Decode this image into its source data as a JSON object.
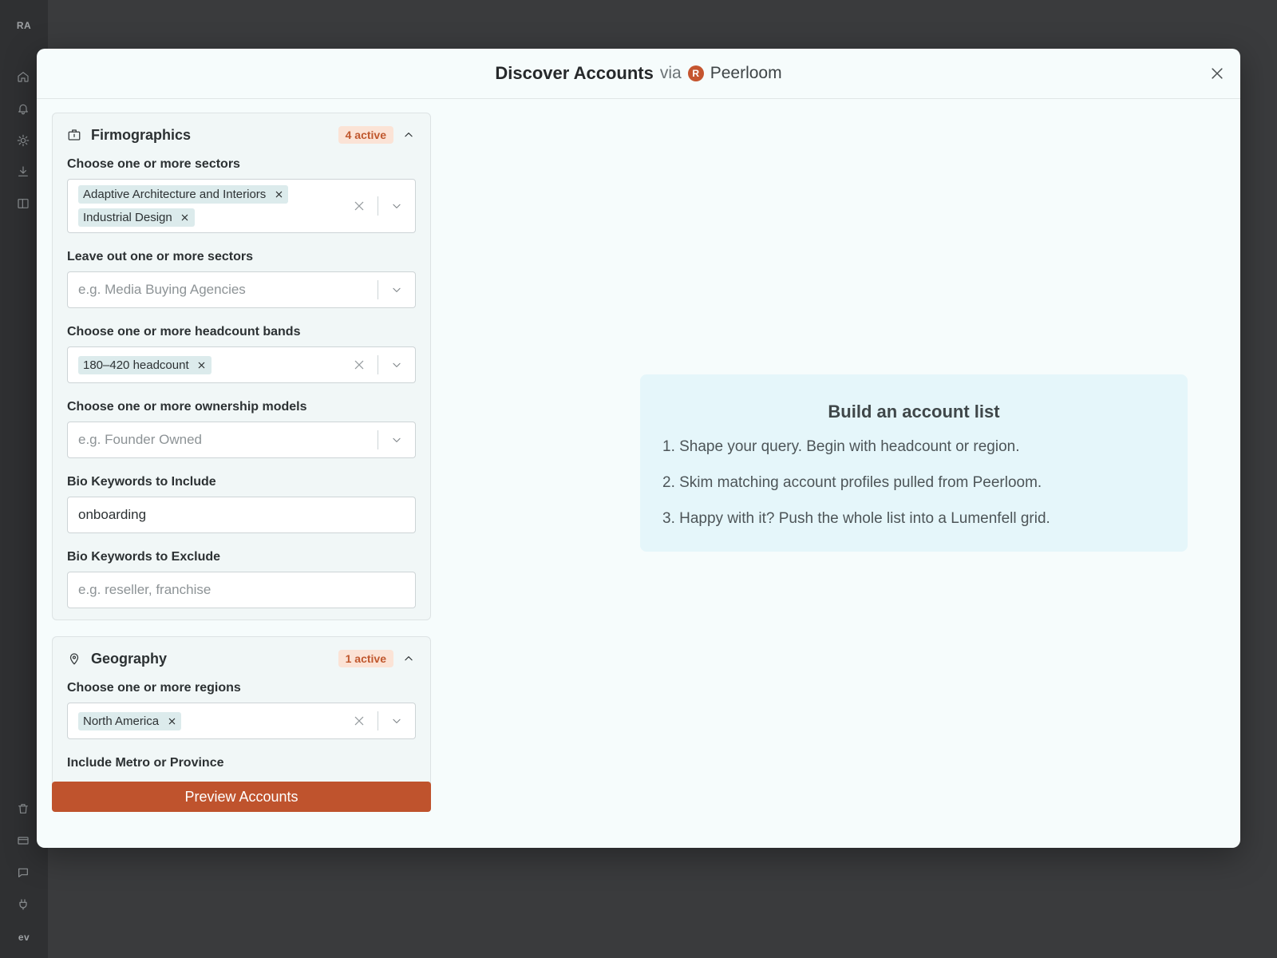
{
  "rail": {
    "workspace_top": "RA",
    "workspace_bottom": "ev",
    "icons_top": [
      "home-icon",
      "bell-icon",
      "sun-icon",
      "download-icon",
      "layout-icon"
    ],
    "icons_bottom": [
      "trash-icon",
      "card-icon",
      "chat-icon",
      "plug-icon"
    ]
  },
  "modal": {
    "title": "Discover Accounts",
    "via": "via",
    "brand_initial": "R",
    "brand_name": "Peerloom"
  },
  "firmographics": {
    "title": "Firmographics",
    "badge": "4 active",
    "sectors": {
      "label": "Choose one or more sectors",
      "chips": [
        "Adaptive Architecture and Interiors",
        "Industrial Design"
      ]
    },
    "exclude_sectors": {
      "label": "Leave out one or more sectors",
      "placeholder": "e.g. Media Buying Agencies"
    },
    "headcount": {
      "label": "Choose one or more headcount bands",
      "chips": [
        "180–420 headcount"
      ]
    },
    "ownership": {
      "label": "Choose one or more ownership models",
      "placeholder": "e.g. Founder Owned"
    },
    "bio_include": {
      "label": "Bio Keywords to Include",
      "value": "onboarding"
    },
    "bio_exclude": {
      "label": "Bio Keywords to Exclude",
      "placeholder": "e.g. reseller, franchise"
    }
  },
  "geography": {
    "title": "Geography",
    "badge": "1 active",
    "regions": {
      "label": "Choose one or more regions",
      "chips": [
        "North America"
      ]
    },
    "metro_label": "Include Metro or Province"
  },
  "preview_button": "Preview Accounts",
  "info": {
    "title": "Build an account list",
    "steps": [
      "1. Shape your query. Begin with headcount or region.",
      "2. Skim matching account profiles pulled from Peerloom.",
      "3. Happy with it? Push the whole list into a Lumenfell grid."
    ]
  },
  "colors": {
    "accent": "#bf532d",
    "badge_bg": "#fbe3d6",
    "info_bg": "#e5f6fa"
  }
}
